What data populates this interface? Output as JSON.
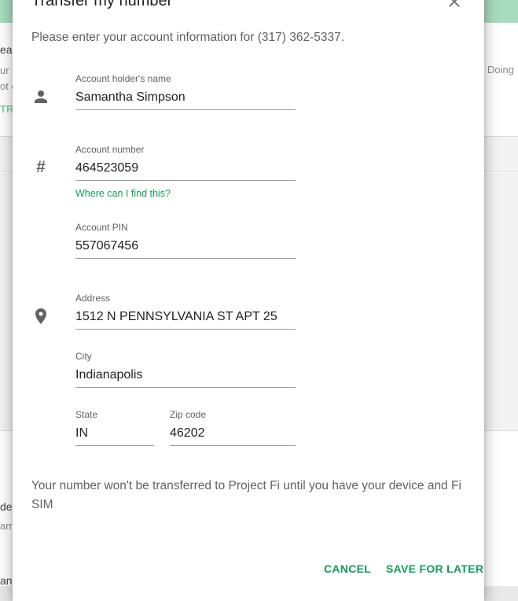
{
  "background": {
    "left_fragments": [
      "eac",
      "ur",
      "ot c",
      "TR",
      "de",
      "arr",
      "an"
    ],
    "right_fragment": "Doing"
  },
  "dialog": {
    "title": "Transfer my number",
    "intro": "Please enter your account information for (317) 362-5337.",
    "fields": {
      "name": {
        "label": "Account holder's name",
        "value": "Samantha Simpson",
        "icon": "person-icon"
      },
      "account_number": {
        "label": "Account number",
        "value": "464523059",
        "icon": "hash-icon"
      },
      "help_link": "Where can I find this?",
      "pin": {
        "label": "Account PIN",
        "value": "557067456"
      },
      "address": {
        "label": "Address",
        "value": "1512 N PENNSYLVANIA ST APT 25",
        "icon": "location-pin-icon"
      },
      "city": {
        "label": "City",
        "value": "Indianapolis"
      },
      "state": {
        "label": "State",
        "value": "IN"
      },
      "zip": {
        "label": "Zip code",
        "value": "46202"
      }
    },
    "notice": "Your number won't be transferred to Project Fi until you have your device and Fi SIM",
    "buttons": {
      "cancel": "CANCEL",
      "save": "SAVE FOR LATER"
    },
    "accent_color": "#0f9d58"
  }
}
